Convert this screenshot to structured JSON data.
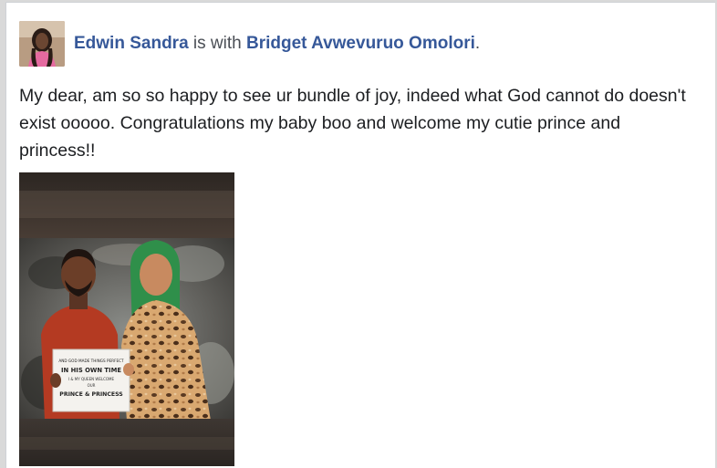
{
  "post": {
    "author": "Edwin Sandra",
    "with_text": "is with",
    "tagged": "Bridget Avwevuruo Omolori",
    "punct": ".",
    "body": "My dear, am so so happy to see ur bundle of joy, indeed what God cannot do doesn't exist ooooo. Congratulations my baby boo and welcome my cutie prince and princess!!"
  },
  "photo": {
    "sign_lines": [
      "AND GOD MADE THINGS PERFECT",
      "IN HIS OWN TIME",
      "I & MY QUEEN WELCOME",
      "OUR",
      "PRINCE & PRINCESS"
    ]
  },
  "colors": {
    "link": "#365899",
    "text": "#1c1e21"
  }
}
